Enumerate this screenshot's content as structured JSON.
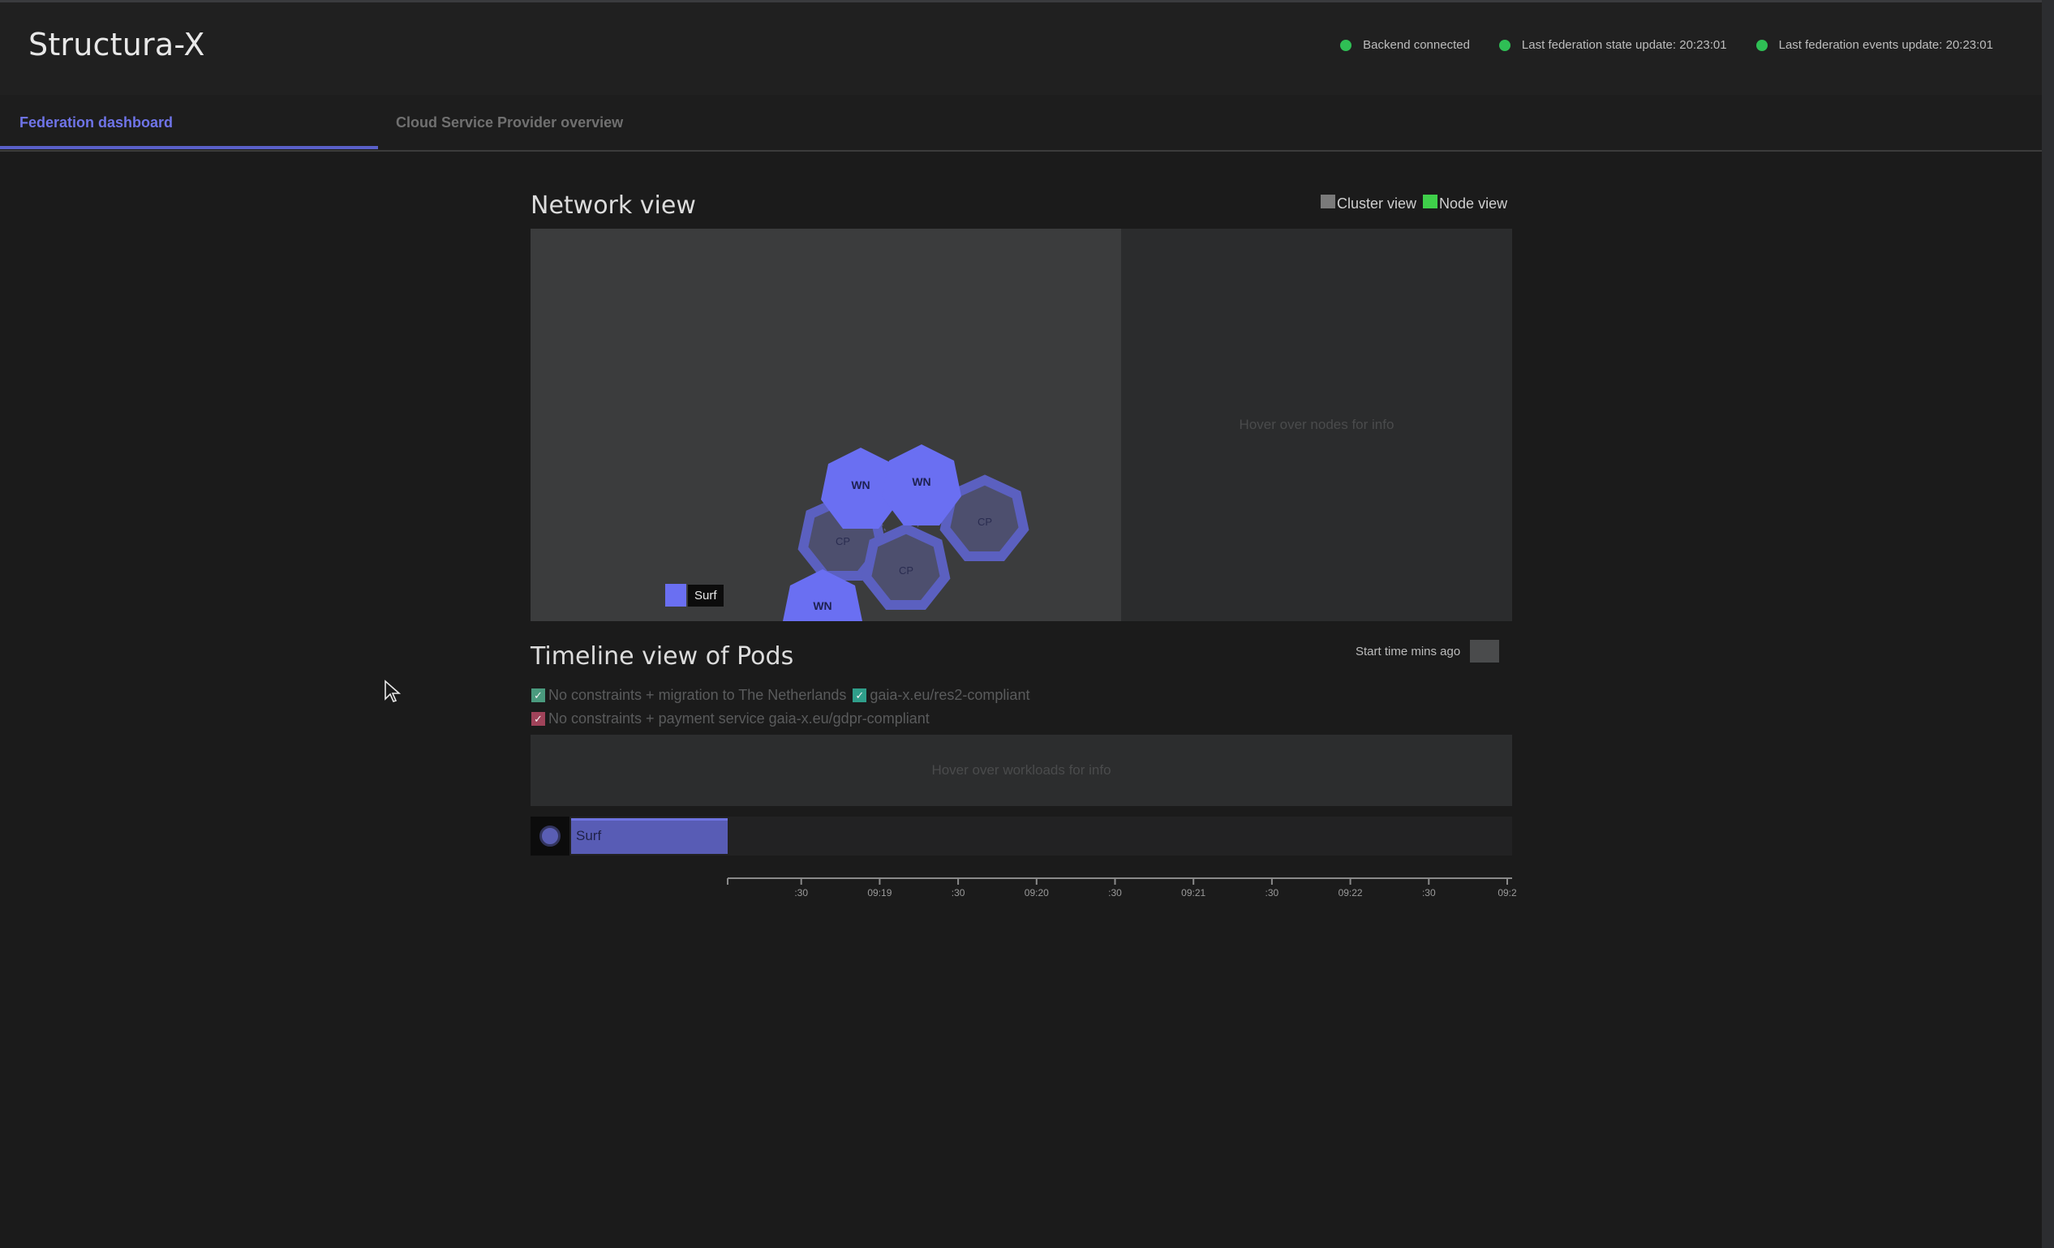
{
  "app": {
    "title": "Structura-X"
  },
  "status": [
    {
      "label": "Backend connected",
      "color": "#2fbf55"
    },
    {
      "label": "Last federation state update: 20:23:01",
      "color": "#2fbf55"
    },
    {
      "label": "Last federation events update: 20:23:01",
      "color": "#2fbf55"
    }
  ],
  "tabs": [
    {
      "label": "Federation dashboard",
      "active": true
    },
    {
      "label": "Cloud Service Provider overview",
      "active": false
    }
  ],
  "network": {
    "title": "Network view",
    "toggles": [
      {
        "label": "Cluster view",
        "color": "#7a7a7a"
      },
      {
        "label": "Node view",
        "color": "#3fcf4a"
      }
    ],
    "info_placeholder": "Hover over nodes for info",
    "legend": [
      {
        "label": "Surf",
        "color": "#6a6ff2"
      }
    ],
    "nodes": [
      {
        "label": "WN",
        "kind": "worker"
      },
      {
        "label": "WN",
        "kind": "worker"
      },
      {
        "label": "WN",
        "kind": "worker"
      },
      {
        "label": "CP",
        "kind": "control-plane"
      },
      {
        "label": "CP",
        "kind": "control-plane"
      },
      {
        "label": "CP",
        "kind": "control-plane"
      }
    ]
  },
  "timeline": {
    "title": "Timeline view of Pods",
    "start_time_label": "Start time mins ago",
    "start_time_value": "",
    "constraints": [
      {
        "items": [
          {
            "label": "No constraints + migration to The Netherlands",
            "color": "#4a9a7e",
            "checked": true
          },
          {
            "label": "gaia-x.eu/res2-compliant",
            "color": "#2f9e8a",
            "checked": true
          }
        ]
      },
      {
        "items": [
          {
            "label": "No constraints + payment service gaia-x.eu/gdpr-compliant",
            "color": "#a0435a",
            "checked": true
          }
        ]
      }
    ],
    "workload_placeholder": "Hover over workloads for info",
    "rows": [
      {
        "label": "Surf",
        "color": "#585cb5"
      }
    ],
    "axis_ticks": [
      ":30",
      "09:19",
      ":30",
      "09:20",
      ":30",
      "09:21",
      ":30",
      "09:22",
      ":30",
      "09:2"
    ]
  }
}
